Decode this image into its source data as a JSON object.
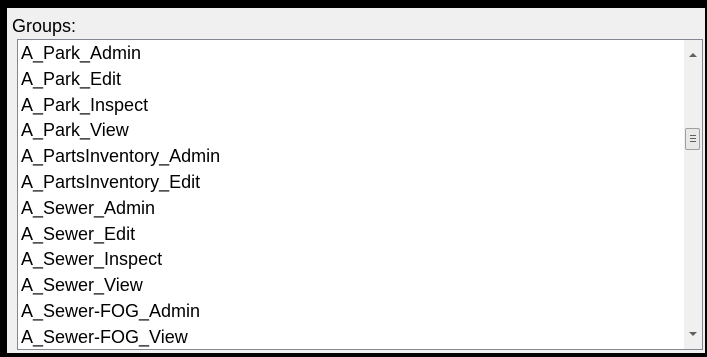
{
  "groups": {
    "label": "Groups:",
    "items": [
      "A_Park_Admin",
      "A_Park_Edit",
      "A_Park_Inspect",
      "A_Park_View",
      "A_PartsInventory_Admin",
      "A_PartsInventory_Edit",
      "A_Sewer_Admin",
      "A_Sewer_Edit",
      "A_Sewer_Inspect",
      "A_Sewer_View",
      "A_Sewer-FOG_Admin",
      "A_Sewer-FOG_View"
    ]
  },
  "scrollbar": {
    "up_icon": "chevron-up-icon",
    "down_icon": "chevron-down-icon",
    "thumb_icon": "scroll-grip-icon"
  },
  "colors": {
    "background": "#000000",
    "panel": "#f0f0f0",
    "list_border": "#828790",
    "list_background": "#ffffff"
  }
}
